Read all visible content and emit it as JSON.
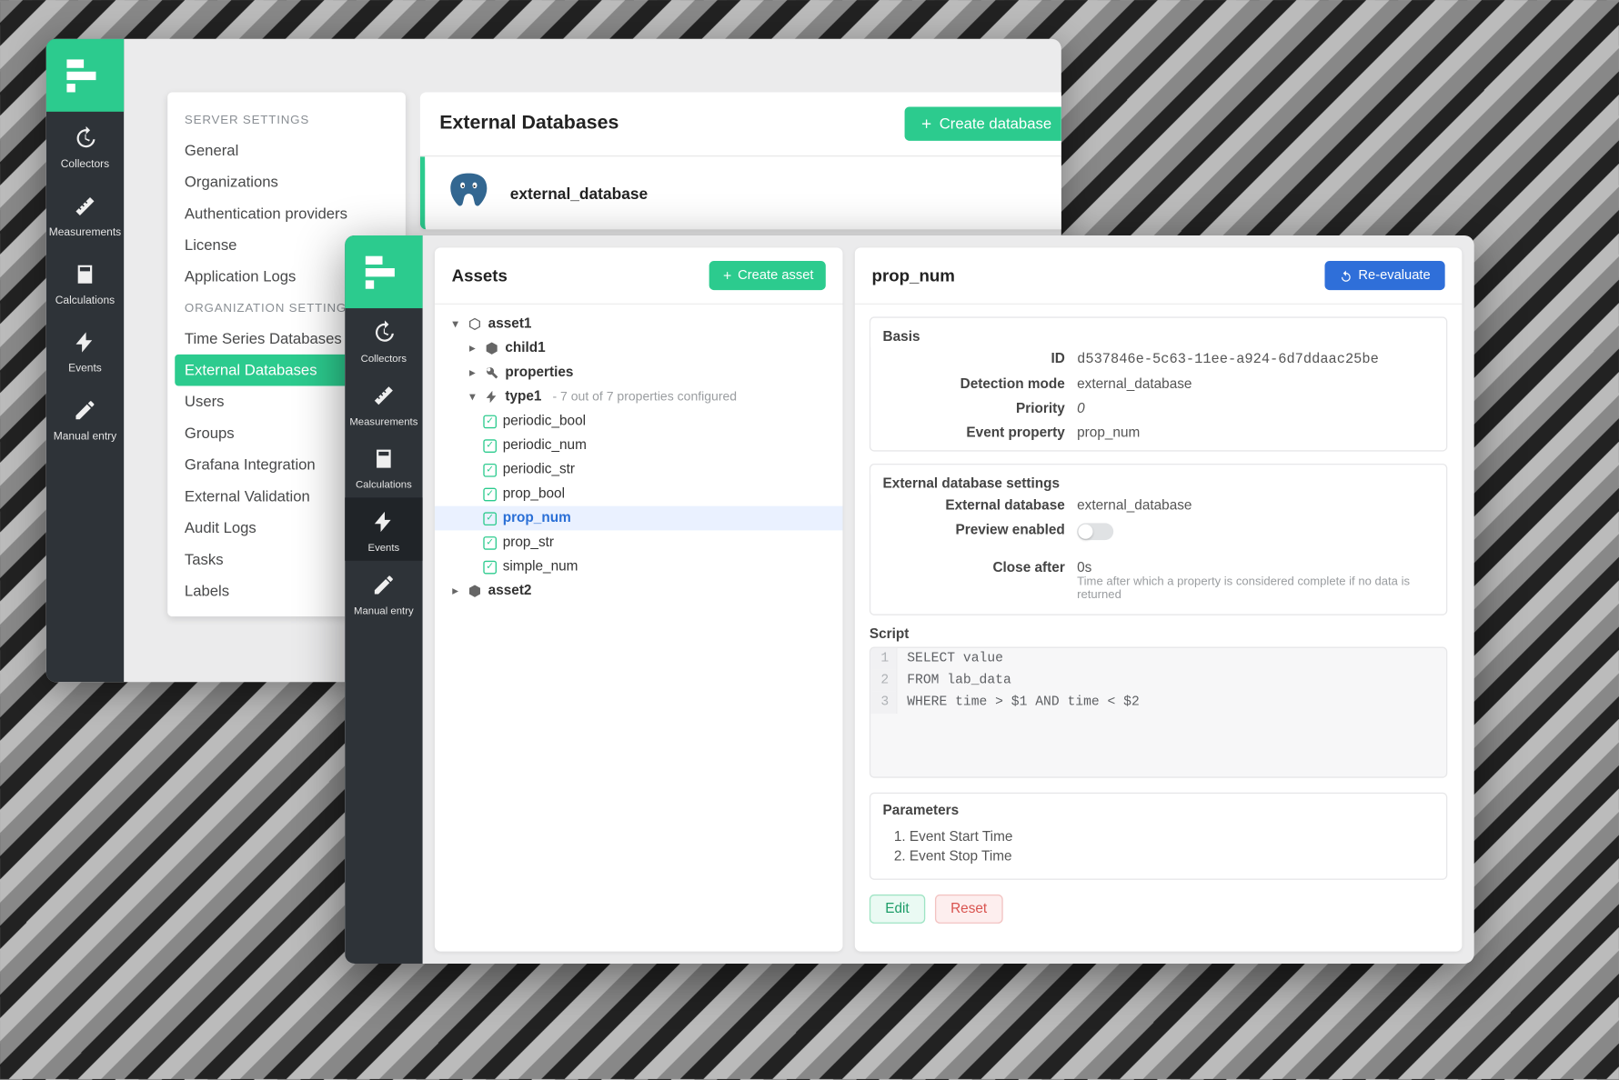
{
  "nav": {
    "items": [
      {
        "label": "Collectors",
        "icon": "history"
      },
      {
        "label": "Measurements",
        "icon": "ruler"
      },
      {
        "label": "Calculations",
        "icon": "calculator"
      },
      {
        "label": "Events",
        "icon": "bolt"
      },
      {
        "label": "Manual entry",
        "icon": "pencil"
      }
    ]
  },
  "settings_panel": {
    "server_heading": "SERVER SETTINGS",
    "server_items": [
      "General",
      "Organizations",
      "Authentication providers",
      "License",
      "Application Logs"
    ],
    "org_heading": "ORGANIZATION SETTINGS",
    "org_items": [
      "Time Series Databases",
      "External Databases",
      "Users",
      "Groups",
      "Grafana Integration",
      "External Validation",
      "Audit Logs",
      "Tasks",
      "Labels"
    ],
    "org_active_index": 1
  },
  "databases": {
    "title": "External Databases",
    "create_label": "Create database",
    "rows": [
      {
        "name": "external_database",
        "kind": "postgres"
      }
    ]
  },
  "assets": {
    "title": "Assets",
    "create_label": "Create asset",
    "tree": {
      "asset1": {
        "label": "asset1",
        "children": {
          "child1": {
            "label": "child1",
            "icon": "box"
          },
          "properties": {
            "label": "properties",
            "icon": "wrench"
          },
          "type1": {
            "label": "type1",
            "icon": "bolt",
            "note": "7 out of 7 properties configured",
            "props": [
              "periodic_bool",
              "periodic_num",
              "periodic_str",
              "prop_bool",
              "prop_num",
              "prop_str",
              "simple_num"
            ],
            "selected_index": 4
          }
        }
      },
      "asset2": {
        "label": "asset2"
      }
    }
  },
  "detail": {
    "title": "prop_num",
    "reeval_label": "Re-evaluate",
    "basis": {
      "heading": "Basis",
      "rows": {
        "id_label": "ID",
        "id_value": "d537846e-5c63-11ee-a924-6d7ddaac25be",
        "mode_label": "Detection mode",
        "mode_value": "external_database",
        "priority_label": "Priority",
        "priority_value": "0",
        "evprop_label": "Event property",
        "evprop_value": "prop_num"
      }
    },
    "extdb": {
      "heading": "External database settings",
      "rows": {
        "db_label": "External database",
        "db_value": "external_database",
        "preview_label": "Preview enabled",
        "preview_on": false,
        "close_label": "Close after",
        "close_value": "0s",
        "close_helper": "Time after which a property is considered complete if no data is returned"
      }
    },
    "script": {
      "heading": "Script",
      "lines": [
        "SELECT value",
        "FROM lab_data",
        "WHERE time > $1 AND time < $2"
      ]
    },
    "parameters": {
      "heading": "Parameters",
      "items": [
        "Event Start Time",
        "Event Stop Time"
      ]
    },
    "actions": {
      "edit": "Edit",
      "reset": "Reset"
    }
  }
}
